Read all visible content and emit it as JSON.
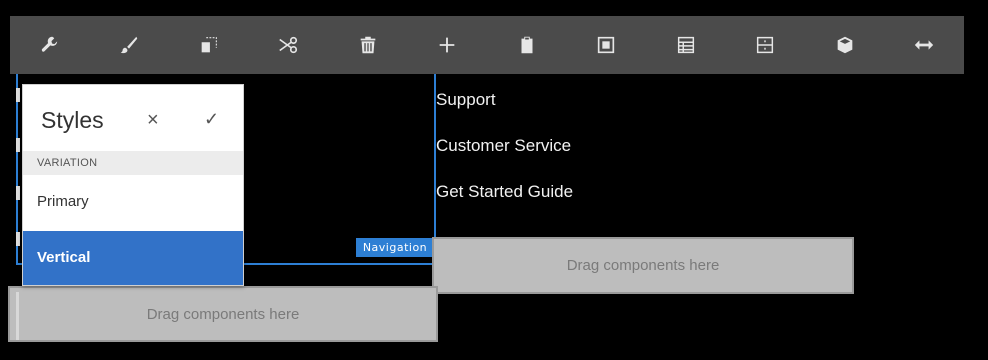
{
  "toolbar": {
    "tools": [
      {
        "name": "wrench-icon"
      },
      {
        "name": "paintbrush-icon"
      },
      {
        "name": "copy-icon"
      },
      {
        "name": "scissors-icon"
      },
      {
        "name": "trash-icon"
      },
      {
        "name": "plus-icon"
      },
      {
        "name": "clipboard-icon"
      },
      {
        "name": "group-icon"
      },
      {
        "name": "table-icon"
      },
      {
        "name": "layout-icon"
      },
      {
        "name": "cube-icon"
      },
      {
        "name": "resize-horizontal-icon"
      }
    ]
  },
  "navigation": {
    "badge": "Navigation",
    "links": [
      "Support",
      "Customer Service",
      "Get Started Guide"
    ]
  },
  "dropzones": {
    "right": "Drag components here",
    "left": "Drag components here"
  },
  "styles_panel": {
    "title": "Styles",
    "close": "×",
    "confirm": "✓",
    "section": "VARIATION",
    "options": [
      {
        "label": "Primary",
        "selected": false
      },
      {
        "label": "Vertical",
        "selected": true
      }
    ]
  },
  "colors": {
    "toolbar_bg": "#4b4b4b",
    "accent": "#2d7fd4",
    "selected_option": "#3272c8",
    "dropzone": "#bdbdbd"
  }
}
